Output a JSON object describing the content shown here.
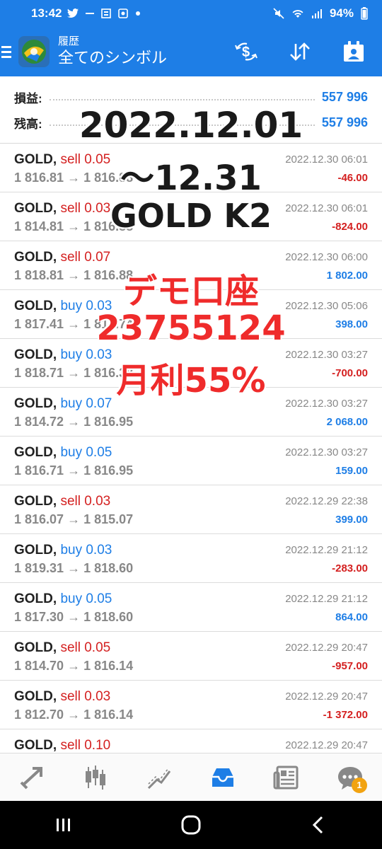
{
  "status": {
    "time": "13:42",
    "battery": "94%"
  },
  "appbar": {
    "subtitle": "履歴",
    "title": "全てのシンボル"
  },
  "summary": {
    "profit_label": "損益:",
    "profit_value": "557 996",
    "balance_label": "残高:",
    "balance_value": "557 996"
  },
  "overlay": {
    "line1": "2022.12.01",
    "line2": "～12.31",
    "line3": "GOLD K2",
    "line4": "デモ口座",
    "line5": "23755124",
    "line6": "月利55%"
  },
  "trades": [
    {
      "symbol": "GOLD,",
      "side": "sell",
      "volume": "sell 0.05",
      "price": "1 816.81 → 1 816.88",
      "date": "2022.12.30 06:01",
      "pl": "-46.00"
    },
    {
      "symbol": "GOLD,",
      "side": "sell",
      "volume": "sell 0.03",
      "price": "1 814.81 → 1 816.88",
      "date": "2022.12.30 06:01",
      "pl": "-824.00"
    },
    {
      "symbol": "GOLD,",
      "side": "sell",
      "volume": "sell 0.07",
      "price": "1 818.81 → 1 816.88",
      "date": "2022.12.30 06:00",
      "pl": "1 802.00"
    },
    {
      "symbol": "GOLD,",
      "side": "buy",
      "volume": "buy 0.03",
      "price": "1 817.41 → 1 818.74",
      "date": "2022.12.30 05:06",
      "pl": "398.00"
    },
    {
      "symbol": "GOLD,",
      "side": "buy",
      "volume": "buy 0.03",
      "price": "1 818.71 → 1 816.38",
      "date": "2022.12.30 03:27",
      "pl": "-700.00"
    },
    {
      "symbol": "GOLD,",
      "side": "buy",
      "volume": "buy 0.07",
      "price": "1 814.72 → 1 816.95",
      "date": "2022.12.30 03:27",
      "pl": "2 068.00"
    },
    {
      "symbol": "GOLD,",
      "side": "buy",
      "volume": "buy 0.05",
      "price": "1 816.71 → 1 816.95",
      "date": "2022.12.30 03:27",
      "pl": "159.00"
    },
    {
      "symbol": "GOLD,",
      "side": "sell",
      "volume": "sell 0.03",
      "price": "1 816.07 → 1 815.07",
      "date": "2022.12.29 22:38",
      "pl": "399.00"
    },
    {
      "symbol": "GOLD,",
      "side": "buy",
      "volume": "buy 0.03",
      "price": "1 819.31 → 1 818.60",
      "date": "2022.12.29 21:12",
      "pl": "-283.00"
    },
    {
      "symbol": "GOLD,",
      "side": "buy",
      "volume": "buy 0.05",
      "price": "1 817.30 → 1 818.60",
      "date": "2022.12.29 21:12",
      "pl": "864.00"
    },
    {
      "symbol": "GOLD,",
      "side": "sell",
      "volume": "sell 0.05",
      "price": "1 814.70 → 1 816.14",
      "date": "2022.12.29 20:47",
      "pl": "-957.00"
    },
    {
      "symbol": "GOLD,",
      "side": "sell",
      "volume": "sell 0.03",
      "price": "1 812.70 → 1 816.14",
      "date": "2022.12.29 20:47",
      "pl": "-1 372.00"
    },
    {
      "symbol": "GOLD,",
      "side": "sell",
      "volume": "sell 0.10",
      "price": "",
      "date": "2022.12.29 20:47",
      "pl": ""
    }
  ],
  "bottom_nav": {
    "chat_badge": "1"
  },
  "colors": {
    "brand_blue": "#1e7ee6",
    "sell_red": "#d42020",
    "overlay_red": "#ef2b2b"
  }
}
